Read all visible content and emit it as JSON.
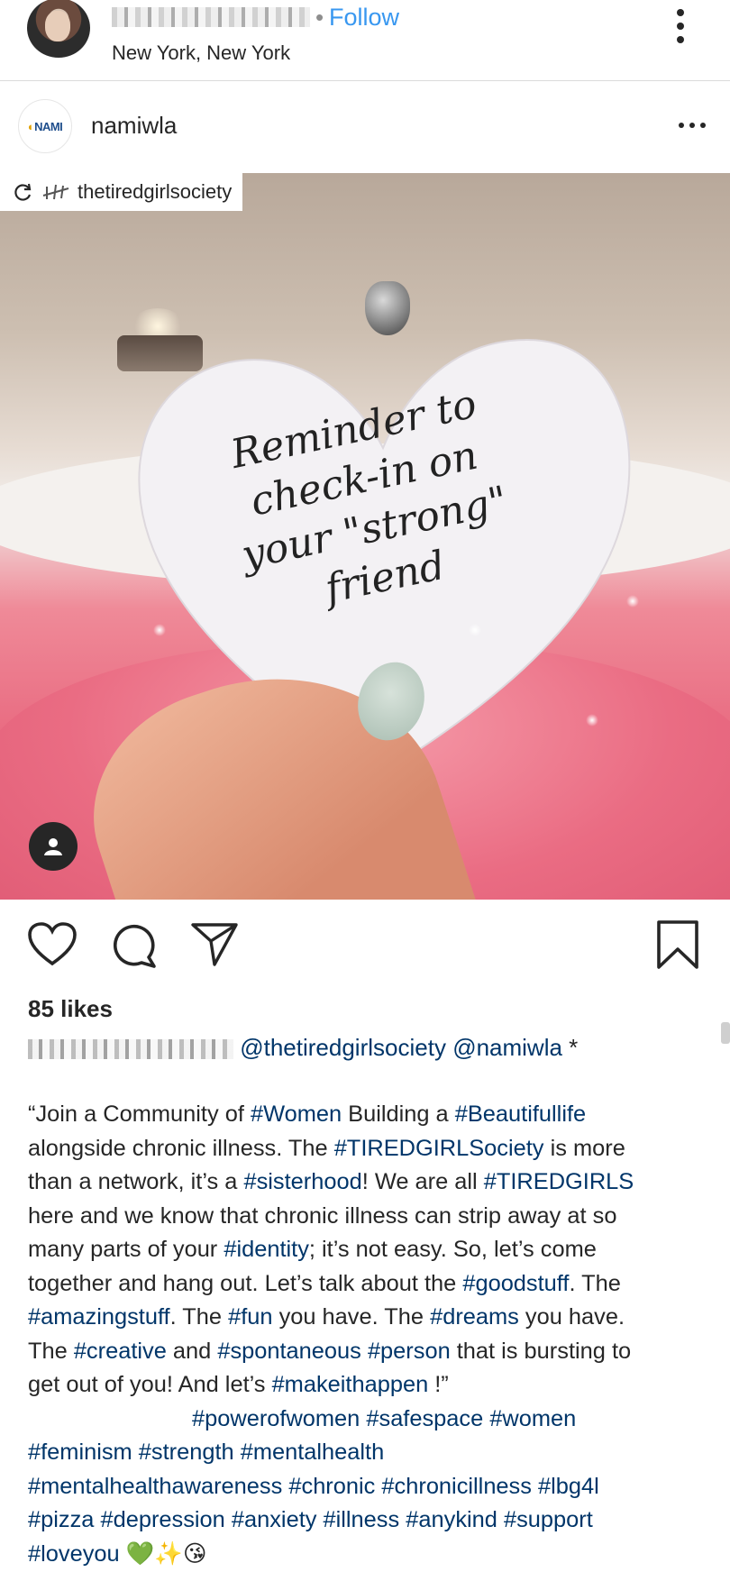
{
  "post_header": {
    "follow_separator": "•",
    "follow_label": "Follow",
    "location": "New York, New York"
  },
  "shared_post": {
    "username": "namiwla",
    "logo_text_a": "NAMI",
    "attribution_username": "thetiredgirlsociety"
  },
  "photo": {
    "handwritten_note": [
      "Reminder to",
      "check-in on",
      "your \"strong\"",
      "friend"
    ]
  },
  "engagement": {
    "likes": "85 likes"
  },
  "tagline": {
    "mention_1": "@thetiredgirlsociety",
    "mention_2": "@namiwla",
    "suffix": " *"
  },
  "caption": {
    "l1": [
      "“Join a Community of ",
      "#Women",
      " Building a ",
      "#Beautifullife"
    ],
    "l2": [
      "alongside chronic illness. The ",
      "#TIREDGIRLSociety",
      " is more"
    ],
    "l3": [
      "than a network, it’s a ",
      "#sisterhood",
      "!  We are all ",
      "#TIREDGIRLS"
    ],
    "l4": [
      "here and we know that chronic illness can strip away at so"
    ],
    "l5": [
      "many parts of your ",
      "#identity",
      "; it’s not easy. So, let’s come"
    ],
    "l6": [
      "together and hang out. Let’s talk about the ",
      "#goodstuff",
      ".  The"
    ],
    "l7": [
      "#amazingstuff",
      ". The ",
      "#fun",
      " you have. The ",
      "#dreams",
      " you have."
    ],
    "l8": [
      "The ",
      "#creative",
      " and ",
      "#spontaneous",
      " ",
      "#person",
      " that is bursting to"
    ],
    "l9": [
      "get out of you!  And let’s ",
      "#makeithappen",
      " !”"
    ],
    "l10": [
      "#powerofwomen",
      "#safespace",
      "#women"
    ],
    "l11": [
      "#feminism",
      "#strength",
      "#mentalhealth"
    ],
    "l12": [
      "#mentalhealthawareness",
      "#chronic",
      "#chronicillness",
      "#lbg4l"
    ],
    "l13": [
      "#pizza",
      "#depression",
      "#anxiety",
      "#illness",
      "#anykind",
      "#support"
    ],
    "l14": [
      "#loveyou"
    ],
    "emoji_tail": [
      "💚",
      "✨",
      "😘"
    ]
  },
  "colors": {
    "follow_blue": "#3897f0",
    "hashtag_blue": "#003569",
    "text": "#262626"
  },
  "icons": [
    "more-vertical-icon",
    "more-horizontal-icon",
    "repost-icon",
    "user-tag-icon",
    "heart-icon",
    "comment-icon",
    "share-icon",
    "bookmark-icon"
  ]
}
